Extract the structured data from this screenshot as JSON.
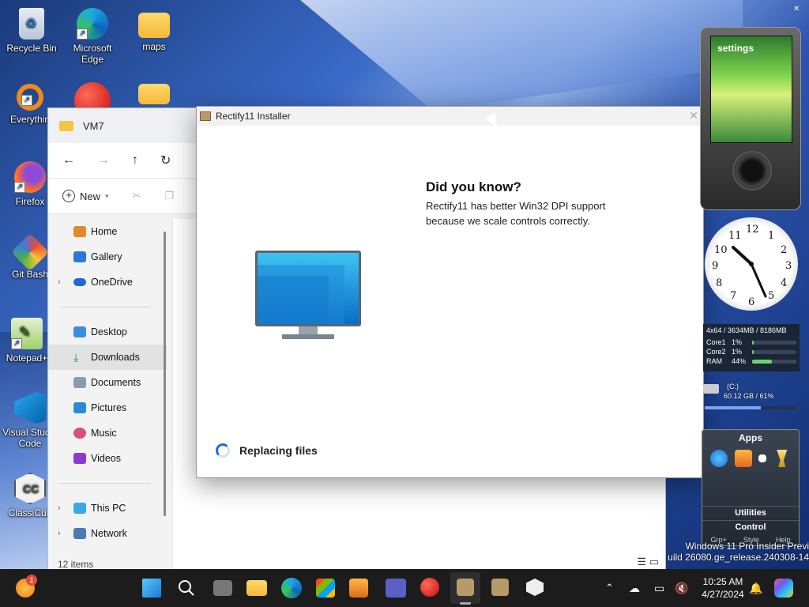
{
  "desktop": {
    "icons": [
      {
        "label": "Recycle Bin"
      },
      {
        "label": "Microsoft Edge"
      },
      {
        "label": "maps"
      },
      {
        "label": "Everythin"
      },
      {
        "label": "Firefox"
      },
      {
        "label": "Git Bash"
      },
      {
        "label": "Notepad+"
      },
      {
        "label": "Visual Studio Code"
      },
      {
        "label": "ClassiCub"
      }
    ],
    "watermark_line1": "Windows 11 Pro Insider Previ",
    "watermark_line2": "uild 26080.ge_release.240308-14"
  },
  "explorer": {
    "title": "VM7",
    "new_label": "New",
    "nav_items": [
      {
        "label": "Home"
      },
      {
        "label": "Gallery"
      },
      {
        "label": "OneDrive"
      },
      {
        "label": "Desktop"
      },
      {
        "label": "Downloads"
      },
      {
        "label": "Documents"
      },
      {
        "label": "Pictures"
      },
      {
        "label": "Music"
      },
      {
        "label": "Videos"
      },
      {
        "label": "This PC"
      },
      {
        "label": "Network"
      }
    ],
    "status": "12 items"
  },
  "installer": {
    "title": "Rectify11 Installer",
    "heading": "Did you know?",
    "body": "Rectify11 has better Win32 DPI support because we scale controls correctly.",
    "status": "Replacing files"
  },
  "gadgets": {
    "zune_label": "settings",
    "meter_header": "4x64 / 3634MB / 8186MB",
    "meter_rows": [
      {
        "name": "Core1",
        "pct": "1%",
        "value": 0.01
      },
      {
        "name": "Core2",
        "pct": "1%",
        "value": 0.01
      },
      {
        "name": "RAM",
        "pct": "44%",
        "value": 0.44
      }
    ],
    "drive_label": "(C:)",
    "drive_info": "60.12 GB / 61%",
    "drive_fill": 0.61,
    "apps_title": "Apps",
    "apps_utilities": "Utilities",
    "apps_control": "Control",
    "apps_footer": [
      "Grp+",
      "Style",
      "Help"
    ]
  },
  "taskbar": {
    "time": "10:25 AM",
    "date": "4/27/2024",
    "notification_badge": "1"
  },
  "colors": {
    "accent": "#1f6fcf",
    "taskbar": "#1c1c1c"
  }
}
